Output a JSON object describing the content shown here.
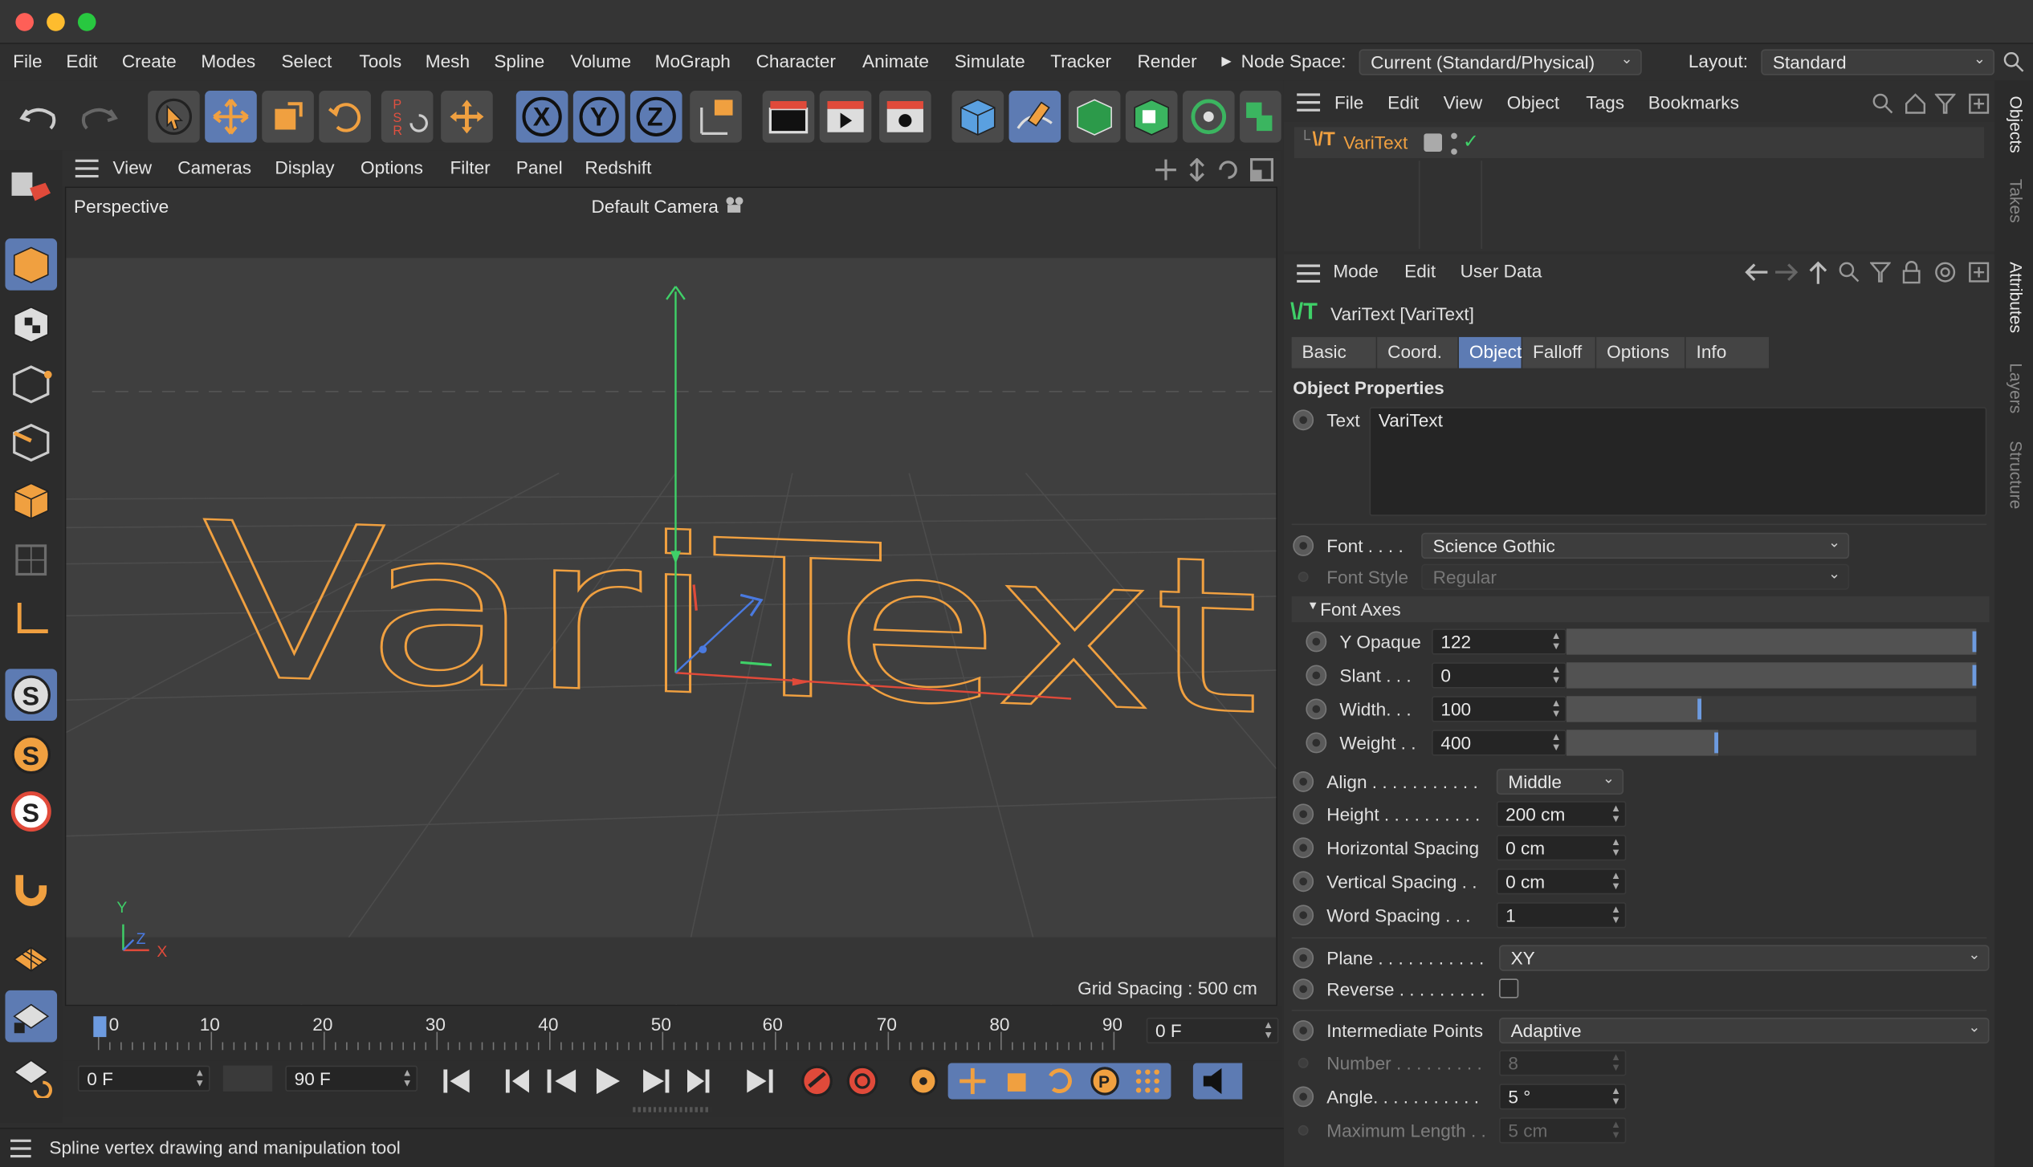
{
  "app": {
    "menu": [
      "File",
      "Edit",
      "Create",
      "Modes",
      "Select",
      "Tools",
      "Mesh",
      "Spline",
      "Volume",
      "MoGraph",
      "Character",
      "Animate",
      "Simulate",
      "Tracker",
      "Render"
    ],
    "node_space_label": "Node Space:",
    "node_space_value": "Current (Standard/Physical)",
    "layout_label": "Layout:",
    "layout_value": "Standard"
  },
  "viewport": {
    "menu": [
      "View",
      "Cameras",
      "Display",
      "Options",
      "Filter",
      "Panel",
      "Redshift"
    ],
    "projection": "Perspective",
    "camera": "Default Camera",
    "grid_spacing": "Grid Spacing : 500 cm",
    "scene_text": "VariText",
    "axis_y": "Y",
    "axis_z": "Z",
    "axis_x": "X"
  },
  "timeline": {
    "ticks": [
      "0",
      "10",
      "20",
      "30",
      "40",
      "50",
      "60",
      "70",
      "80",
      "90"
    ],
    "current_frame": "0 F",
    "start_frame": "0 F",
    "end_frame": "90 F"
  },
  "status": {
    "text": "Spline vertex drawing and manipulation tool"
  },
  "objects": {
    "menu": [
      "File",
      "Edit",
      "View",
      "Object",
      "Tags",
      "Bookmarks"
    ],
    "items": [
      {
        "name": "VariText"
      }
    ]
  },
  "attributes": {
    "menu": [
      "Mode",
      "Edit",
      "User Data"
    ],
    "object_title": "VariText [VariText]",
    "tabs": [
      "Basic",
      "Coord.",
      "Object",
      "Falloff",
      "Options",
      "Info"
    ],
    "active_tab": "Object",
    "section": "Object Properties",
    "text_label": "Text",
    "text_value": "VariText",
    "font_label": "Font . . . .",
    "font_value": "Science Gothic",
    "font_style_label": "Font Style",
    "font_style_value": "Regular",
    "font_axes_label": "Font Axes",
    "axes": [
      {
        "label": "Y Opaque",
        "value": "122",
        "level": 1.0
      },
      {
        "label": "Slant . . .",
        "value": "0",
        "level": 1.0
      },
      {
        "label": "Width. . .",
        "value": "100",
        "level": 0.33
      },
      {
        "label": "Weight . .",
        "value": "400",
        "level": 0.37
      }
    ],
    "align_label": "Align . . . . . . . . . . .",
    "align_value": "Middle",
    "height_label": "Height . . . . . . . . . .",
    "height_value": "200 cm",
    "hspacing_label": "Horizontal Spacing",
    "hspacing_value": "0 cm",
    "vspacing_label": "Vertical Spacing . .",
    "vspacing_value": "0 cm",
    "wordspacing_label": "Word Spacing . . .",
    "wordspacing_value": "1",
    "plane_label": "Plane . . . . . . . . . . .",
    "plane_value": "XY",
    "reverse_label": "Reverse . . . . . . . . .",
    "intermediate_label": "Intermediate Points",
    "intermediate_value": "Adaptive",
    "number_label": "Number . . . . . . . . .",
    "number_value": "8",
    "angle_label": "Angle. . . . . . . . . . .",
    "angle_value": "5 °",
    "maxlen_label": "Maximum Length . .",
    "maxlen_value": "5 cm"
  },
  "sidetabs": [
    "Objects",
    "Takes",
    "Attributes",
    "Layers",
    "Structure"
  ],
  "colors": {
    "accent": "#5d7bb3",
    "spline": "#f0a040",
    "orange": "#e8922c"
  }
}
